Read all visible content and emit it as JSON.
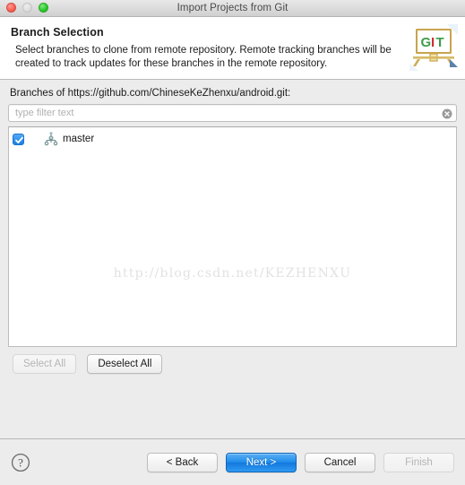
{
  "window": {
    "title": "Import Projects from Git",
    "traffic_lights": [
      {
        "name": "close",
        "color": "#f9655a",
        "state": "enabled"
      },
      {
        "name": "minimize",
        "color": "#dddddd",
        "state": "disabled"
      },
      {
        "name": "zoom",
        "color": "#2ecb2e",
        "state": "enabled"
      }
    ]
  },
  "header": {
    "title": "Branch Selection",
    "description": "Select branches to clone from remote repository. Remote tracking branches will be created to track updates for these branches in the remote repository.",
    "icon": {
      "name": "git-easel-icon",
      "text": "GIT",
      "letter_colors": [
        "#2f9c3a",
        "#cc2222",
        "#2f9c3a"
      ]
    }
  },
  "content": {
    "branches_label": "Branches of https://github.com/ChineseKeZhenxu/android.git:",
    "filter": {
      "value": "",
      "placeholder": "type filter text",
      "clear_icon": "clear-circle-icon"
    },
    "branches": [
      {
        "name": "master",
        "checked": true,
        "icon": "git-branch-icon"
      }
    ],
    "watermark": "http://blog.csdn.net/KEZHENXU",
    "select_all_label": "Select All",
    "select_all_enabled": false,
    "deselect_all_label": "Deselect All",
    "deselect_all_enabled": true
  },
  "footer": {
    "help_icon": "help-question-icon",
    "buttons": [
      {
        "label": "< Back",
        "style": "normal"
      },
      {
        "label": "Next >",
        "style": "primary"
      },
      {
        "label": "Cancel",
        "style": "normal"
      },
      {
        "label": "Finish",
        "style": "disabled"
      }
    ]
  },
  "colors": {
    "accent": "#1e8ceb",
    "checkbox": "#1b7fe3",
    "window_bg": "#ececec",
    "field_bg": "#ffffff"
  }
}
